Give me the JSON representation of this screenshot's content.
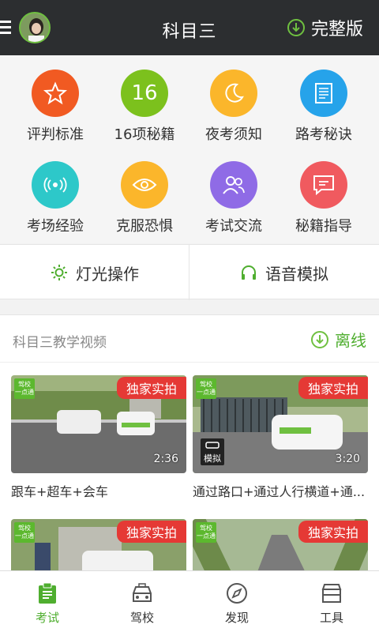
{
  "header": {
    "title": "科目三",
    "full_version_label": "完整版"
  },
  "grid": [
    {
      "label": "评判标准",
      "icon": "star-icon",
      "color": "#f15a22",
      "glyph": "☆"
    },
    {
      "label": "16项秘籍",
      "icon": "number-16-icon",
      "color": "#7cc11d",
      "glyph": "16"
    },
    {
      "label": "夜考须知",
      "icon": "moon-icon",
      "color": "#fbb62b",
      "glyph": "☾"
    },
    {
      "label": "路考秘诀",
      "icon": "document-icon",
      "color": "#26a3ea",
      "glyph": "≣"
    },
    {
      "label": "考场经验",
      "icon": "broadcast-icon",
      "color": "#2dc8c9",
      "glyph": "((•))"
    },
    {
      "label": "克服恐惧",
      "icon": "eye-icon",
      "color": "#fbb62b",
      "glyph": "◉"
    },
    {
      "label": "考试交流",
      "icon": "users-icon",
      "color": "#8f6be6",
      "glyph": "⚇"
    },
    {
      "label": "秘籍指导",
      "icon": "message-icon",
      "color": "#f05a5f",
      "glyph": "✉"
    }
  ],
  "actions": {
    "lights_label": "灯光操作",
    "voice_label": "语音模拟"
  },
  "videos": {
    "section_title": "科目三教学视频",
    "offline_label": "离线",
    "items": [
      {
        "badge": "独家实拍",
        "duration": "2:36",
        "caption": "跟车+超车+会车",
        "logo": "驾校 一点通"
      },
      {
        "badge": "独家实拍",
        "duration": "3:20",
        "caption": "通过路口+通过人行横道+通...",
        "logo": "驾校 一点通",
        "sim": "模拟"
      },
      {
        "badge": "独家实拍",
        "logo": "驾校 一点通"
      },
      {
        "badge": "独家实拍",
        "logo": "驾校 一点通"
      }
    ]
  },
  "nav": [
    {
      "label": "考试",
      "icon": "exam-icon"
    },
    {
      "label": "驾校",
      "icon": "car-icon"
    },
    {
      "label": "发现",
      "icon": "compass-icon"
    },
    {
      "label": "工具",
      "icon": "toolbox-icon"
    }
  ],
  "colors": {
    "accent": "#4fae2f",
    "header_bg": "#2c2e30",
    "badge_red": "#e53935"
  }
}
